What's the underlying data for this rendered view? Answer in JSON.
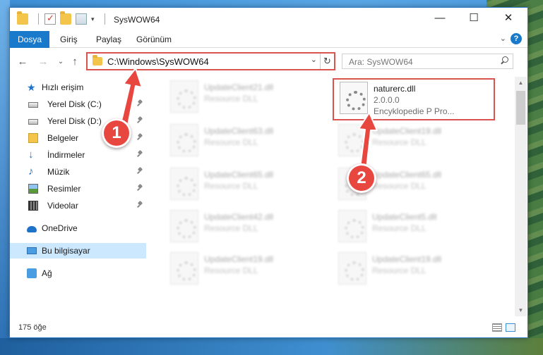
{
  "window": {
    "title": "SysWOW64",
    "minimize_glyph": "—",
    "maximize_glyph": "☐",
    "close_glyph": "✕"
  },
  "ribbon": {
    "file_tab": "Dosya",
    "tabs": [
      "Giriş",
      "Paylaş",
      "Görünüm"
    ],
    "expand_glyph": "⌄",
    "help_glyph": "?"
  },
  "nav": {
    "back_glyph": "←",
    "forward_glyph": "→",
    "recent_glyph": "⌄",
    "up_glyph": "↑",
    "address": "C:\\Windows\\SysWOW64",
    "address_dropdown_glyph": "⌄",
    "refresh_glyph": "↻",
    "search_placeholder": "Ara: SysWOW64"
  },
  "sidebar": {
    "items": [
      {
        "label": "Hızlı erişim",
        "icon": "star-icon"
      },
      {
        "label": "Yerel Disk (C:)",
        "icon": "disk-icon",
        "pinned": true
      },
      {
        "label": "Yerel Disk (D:)",
        "icon": "disk-icon",
        "pinned": true
      },
      {
        "label": "Belgeler",
        "icon": "documents-icon",
        "pinned": true
      },
      {
        "label": "İndirmeler",
        "icon": "download-icon",
        "pinned": true
      },
      {
        "label": "Müzik",
        "icon": "music-icon",
        "pinned": true
      },
      {
        "label": "Resimler",
        "icon": "pictures-icon",
        "pinned": true
      },
      {
        "label": "Videolar",
        "icon": "video-icon",
        "pinned": true
      },
      {
        "label": "OneDrive",
        "icon": "cloud-icon"
      },
      {
        "label": "Bu bilgisayar",
        "icon": "computer-icon",
        "selected": true
      },
      {
        "label": "Ağ",
        "icon": "network-icon"
      }
    ]
  },
  "files": {
    "highlighted": {
      "name": "naturerc.dll",
      "version": "2.0.0.0",
      "company": "Encyklopedie P   Pro..."
    },
    "left_column": [
      {
        "name": "UpdateClient21.dll",
        "type": "Resource DLL"
      },
      {
        "name": "UpdateClient63.dll",
        "type": "Resource DLL"
      },
      {
        "name": "UpdateClient65.dll",
        "type": "Resource DLL"
      },
      {
        "name": "UpdateClient42.dll",
        "type": "Resource DLL"
      },
      {
        "name": "UpdateClient19.dll",
        "type": "Resource DLL"
      }
    ],
    "right_column": [
      {
        "name": "UpdateClient19.dll",
        "type": "Resource DLL"
      },
      {
        "name": "UpdateClient65.dll",
        "type": "Resource DLL"
      },
      {
        "name": "UpdateClient5.dll",
        "type": "Resource DLL"
      },
      {
        "name": "UpdateClient19.dll",
        "type": "Resource DLL"
      }
    ]
  },
  "status": {
    "item_count": "175 öğe"
  },
  "annotations": {
    "step1": "1",
    "step2": "2",
    "color": "#e8473f"
  }
}
